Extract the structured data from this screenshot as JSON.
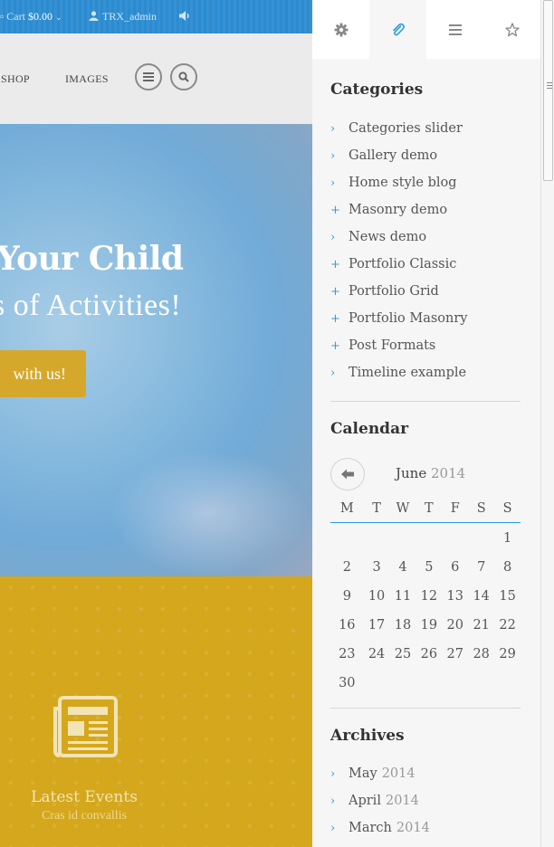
{
  "topbar": {
    "cart_label": "Cart",
    "cart_amount": "$0.00",
    "user_name": "TRX_admin"
  },
  "nav": {
    "items": [
      {
        "label": "SHOP"
      },
      {
        "label": "IMAGES"
      }
    ]
  },
  "hero": {
    "title": "Your Child",
    "subtitle": "s of Activities!",
    "button_label": "with us!"
  },
  "events": {
    "title": "Latest Events",
    "subtitle": "Cras id convallis"
  },
  "sidebar": {
    "tabs": [
      {
        "icon": "gear-icon",
        "active": false
      },
      {
        "icon": "paperclip-icon",
        "active": true
      },
      {
        "icon": "menu-icon",
        "active": false
      },
      {
        "icon": "star-icon",
        "active": false
      }
    ],
    "categories": {
      "title": "Categories",
      "items": [
        {
          "label": "Categories slider",
          "marker": "›"
        },
        {
          "label": "Gallery demo",
          "marker": "›"
        },
        {
          "label": "Home style blog",
          "marker": "›"
        },
        {
          "label": "Masonry demo",
          "marker": "+"
        },
        {
          "label": "News demo",
          "marker": "›"
        },
        {
          "label": "Portfolio Classic",
          "marker": "+"
        },
        {
          "label": "Portfolio Grid",
          "marker": "+"
        },
        {
          "label": "Portfolio Masonry",
          "marker": "+"
        },
        {
          "label": "Post Formats",
          "marker": "+"
        },
        {
          "label": "Timeline example",
          "marker": "›"
        }
      ]
    },
    "calendar": {
      "title": "Calendar",
      "month": "June",
      "year": "2014",
      "weekdays": [
        "M",
        "T",
        "W",
        "T",
        "F",
        "S",
        "S"
      ],
      "weeks": [
        [
          "",
          "",
          "",
          "",
          "",
          "",
          "1"
        ],
        [
          "2",
          "3",
          "4",
          "5",
          "6",
          "7",
          "8"
        ],
        [
          "9",
          "10",
          "11",
          "12",
          "13",
          "14",
          "15"
        ],
        [
          "16",
          "17",
          "18",
          "19",
          "20",
          "21",
          "22"
        ],
        [
          "23",
          "24",
          "25",
          "26",
          "27",
          "28",
          "29"
        ],
        [
          "30",
          "",
          "",
          "",
          "",
          "",
          ""
        ]
      ]
    },
    "archives": {
      "title": "Archives",
      "items": [
        {
          "month": "May",
          "year": "2014"
        },
        {
          "month": "April",
          "year": "2014"
        },
        {
          "month": "March",
          "year": "2014"
        }
      ]
    }
  },
  "colors": {
    "accent": "#2a9be0",
    "topbar": "#2b8bd0",
    "yellow": "#d4a71d",
    "hero_button": "#d5a82c"
  }
}
